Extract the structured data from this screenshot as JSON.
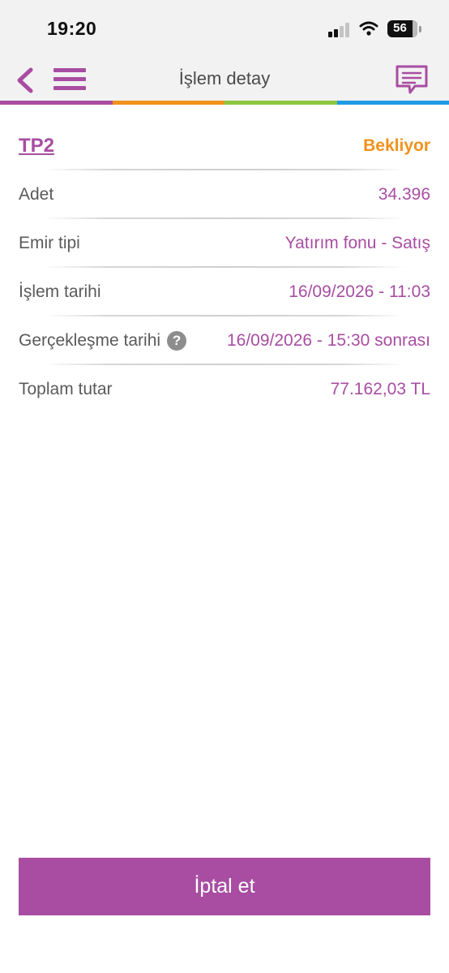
{
  "status_bar": {
    "time": "19:20",
    "battery": "56",
    "icons": [
      "signal-icon",
      "wifi-icon",
      "battery-icon"
    ]
  },
  "nav": {
    "title": "İşlem detay",
    "icons": [
      "back-chevron-icon",
      "hamburger-menu-icon",
      "chat-bubble-icon"
    ]
  },
  "colors": {
    "accent": "#a84da2",
    "pending": "#f0921c",
    "stripe": [
      "#a84da2",
      "#f0921c",
      "#8dc63f",
      "#1e9be5"
    ]
  },
  "transaction": {
    "fund_code": "TP2",
    "status": "Bekliyor",
    "rows": [
      {
        "label": "Adet",
        "value": "34.396"
      },
      {
        "label": "Emir tipi",
        "value": "Yatırım fonu - Satış"
      },
      {
        "label": "İşlem tarihi",
        "value": "16/09/2026 - 11:03"
      },
      {
        "label": "Gerçekleşme tarihi",
        "value": "16/09/2026 - 15:30 sonrası",
        "help": "?"
      },
      {
        "label": "Toplam tutar",
        "value": "77.162,03 TL"
      }
    ]
  },
  "actions": {
    "cancel_label": "İptal et"
  }
}
